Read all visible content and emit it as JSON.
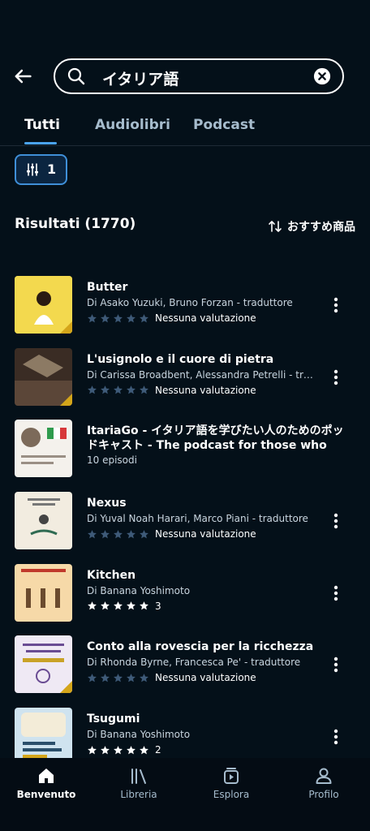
{
  "search": {
    "query": "イタリア語"
  },
  "tabs": [
    {
      "label": "Tutti",
      "active": true
    },
    {
      "label": "Audiolibri",
      "active": false
    },
    {
      "label": "Podcast",
      "active": false
    }
  ],
  "filter": {
    "count": "1"
  },
  "results": {
    "title": "Risultati (1770)",
    "sort_label": "おすすめ商品"
  },
  "items": [
    {
      "title": "Butter",
      "author": "Di Asako Yuzuki, Bruno Forzan - traduttore",
      "stars": 0,
      "rating_text": "Nessuna valutazione",
      "cover_color": "#f3d94e"
    },
    {
      "title": "L'usignolo e il cuore di pietra",
      "author": "Di Carissa Broadbent, Alessandra Petrelli - traduttore",
      "stars": 0,
      "rating_text": "Nessuna valutazione",
      "cover_color": "#3a2c24"
    },
    {
      "title": "ItariaGo - イタリア語を学びたい人のためのポッドキャスト - The podcast for those who want to learn Italian",
      "episodes": "10 episodi",
      "cover_color": "#f4f1ec"
    },
    {
      "title": "Nexus",
      "author": "Di Yuval Noah Harari, Marco Piani - traduttore",
      "stars": 0,
      "rating_text": "Nessuna valutazione",
      "cover_color": "#f2ece0"
    },
    {
      "title": "Kitchen",
      "author": "Di Banana Yoshimoto",
      "stars": 5,
      "rating_text": "3",
      "cover_color": "#f6d9a8"
    },
    {
      "title": "Conto alla rovescia per la ricchezza",
      "author": "Di Rhonda Byrne, Francesca Pe' - traduttore",
      "stars": 0,
      "rating_text": "Nessuna valutazione",
      "cover_color": "#efe9f4"
    },
    {
      "title": "Tsugumi",
      "author": "Di Banana Yoshimoto",
      "stars": 5,
      "rating_text": "2",
      "cover_color": "#cfe3ef"
    }
  ],
  "nav": [
    {
      "label": "Benvenuto",
      "icon": "home-icon",
      "active": true
    },
    {
      "label": "Libreria",
      "icon": "library-icon",
      "active": false
    },
    {
      "label": "Esplora",
      "icon": "explore-icon",
      "active": false
    },
    {
      "label": "Profilo",
      "icon": "profile-icon",
      "active": false
    }
  ],
  "colors": {
    "accent": "#4aa3f0",
    "background": "#041019",
    "star_filled": "#ffffff",
    "star_empty": "#3e5a78"
  }
}
